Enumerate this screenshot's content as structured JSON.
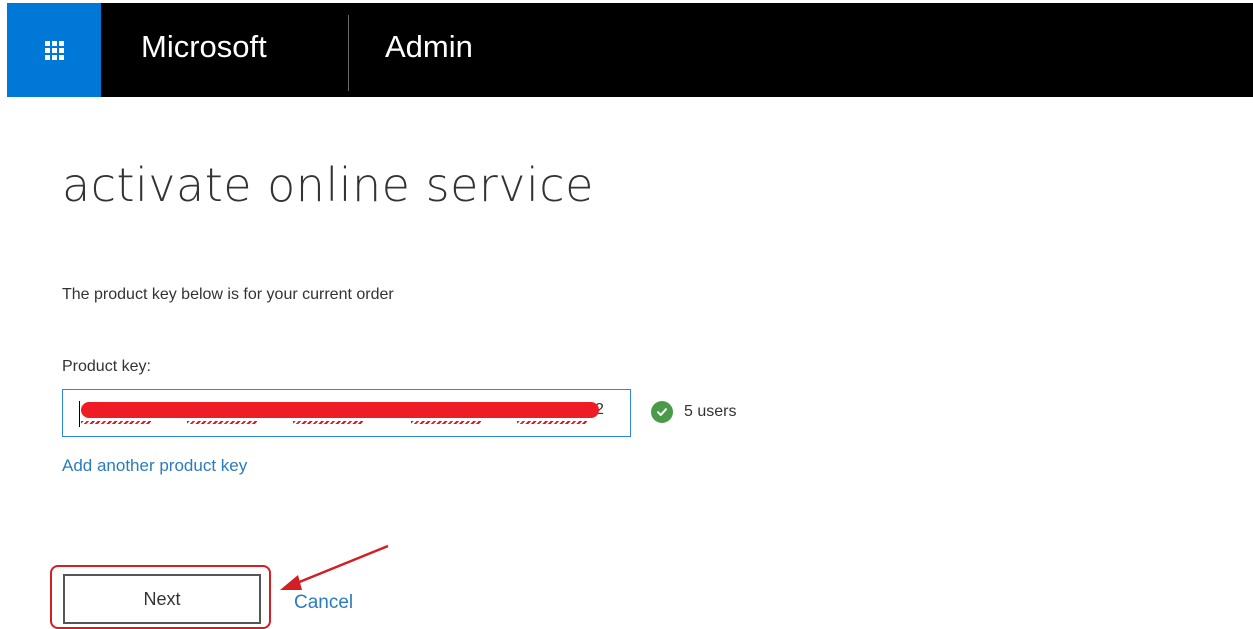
{
  "header": {
    "brand": "Microsoft",
    "app_title": "Admin",
    "bar_color": "#000000",
    "app_launcher_color": "#0078d7",
    "app_launcher_icon": "waffle-icon"
  },
  "page": {
    "title": "activate online service",
    "intro": "The product key below is for your current order"
  },
  "product_key": {
    "label": "Product key:",
    "value": "2",
    "status_icon": "checkmark-icon",
    "status_color": "#4a9a4a",
    "status_text": "5 users"
  },
  "links": {
    "add_another": "Add another product key",
    "cancel": "Cancel",
    "link_color": "#2b7bc0"
  },
  "actions": {
    "next_label": "Next"
  },
  "annotations": {
    "highlight_color": "#d21e24",
    "redaction_color": "#ee1c24"
  }
}
